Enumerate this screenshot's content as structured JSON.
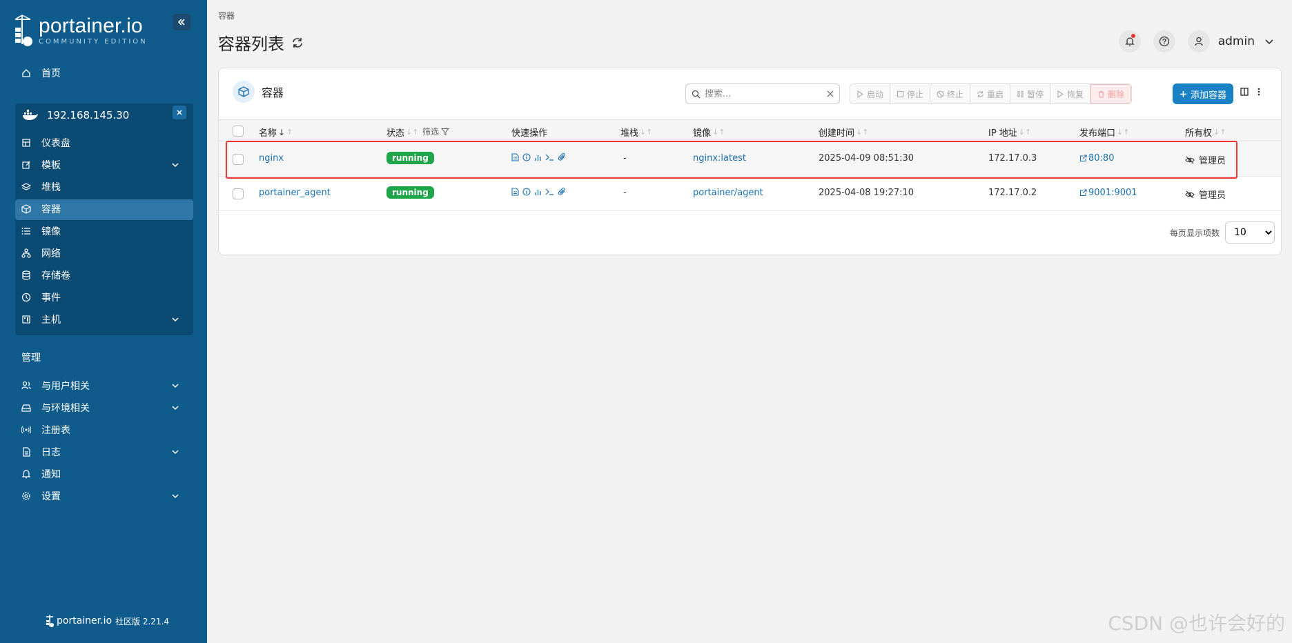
{
  "brand": {
    "name": "portainer.io",
    "edition": "COMMUNITY EDITION"
  },
  "sidebar": {
    "home": "首页",
    "environment": "192.168.145.30",
    "env_items": [
      {
        "label": "仪表盘"
      },
      {
        "label": "模板"
      },
      {
        "label": "堆栈"
      },
      {
        "label": "容器"
      },
      {
        "label": "镜像"
      },
      {
        "label": "网络"
      },
      {
        "label": "存储卷"
      },
      {
        "label": "事件"
      },
      {
        "label": "主机"
      }
    ],
    "section_title": "管理",
    "admin_items": [
      {
        "label": "与用户相关"
      },
      {
        "label": "与环境相关"
      },
      {
        "label": "注册表"
      },
      {
        "label": "日志"
      },
      {
        "label": "通知"
      },
      {
        "label": "设置"
      }
    ],
    "footer_name": "portainer.io",
    "footer_version": "社区版 2.21.4"
  },
  "header": {
    "breadcrumb": "容器",
    "title": "容器列表",
    "user": "admin"
  },
  "card": {
    "title": "容器",
    "search_placeholder": "搜索...",
    "actions": {
      "start": "启动",
      "stop": "停止",
      "kill": "终止",
      "restart": "重启",
      "pause": "暂停",
      "resume": "恢复",
      "remove": "删除"
    },
    "add_label": "添加容器"
  },
  "table": {
    "headers": {
      "name": "名称",
      "state": "状态",
      "filter": "筛选",
      "quick_actions": "快速操作",
      "stack": "堆栈",
      "image": "镜像",
      "created": "创建时间",
      "ip": "IP 地址",
      "ports": "发布端口",
      "ownership": "所有权"
    },
    "rows": [
      {
        "name": "nginx",
        "state": "running",
        "stack": "-",
        "image": "nginx:latest",
        "created": "2025-04-09 08:51:30",
        "ip": "172.17.0.3",
        "ports": "80:80",
        "ownership": "管理员"
      },
      {
        "name": "portainer_agent",
        "state": "running",
        "stack": "-",
        "image": "portainer/agent",
        "created": "2025-04-08 19:27:10",
        "ip": "172.17.0.2",
        "ports": "9001:9001",
        "ownership": "管理员"
      }
    ],
    "per_page_label": "每页显示项数",
    "per_page_value": "10"
  },
  "watermark": "CSDN @也许会好的",
  "colors": {
    "sidebar": "#0f5c8c",
    "accent": "#1a82c4",
    "running": "#1fa64a",
    "highlight": "#e33333"
  }
}
